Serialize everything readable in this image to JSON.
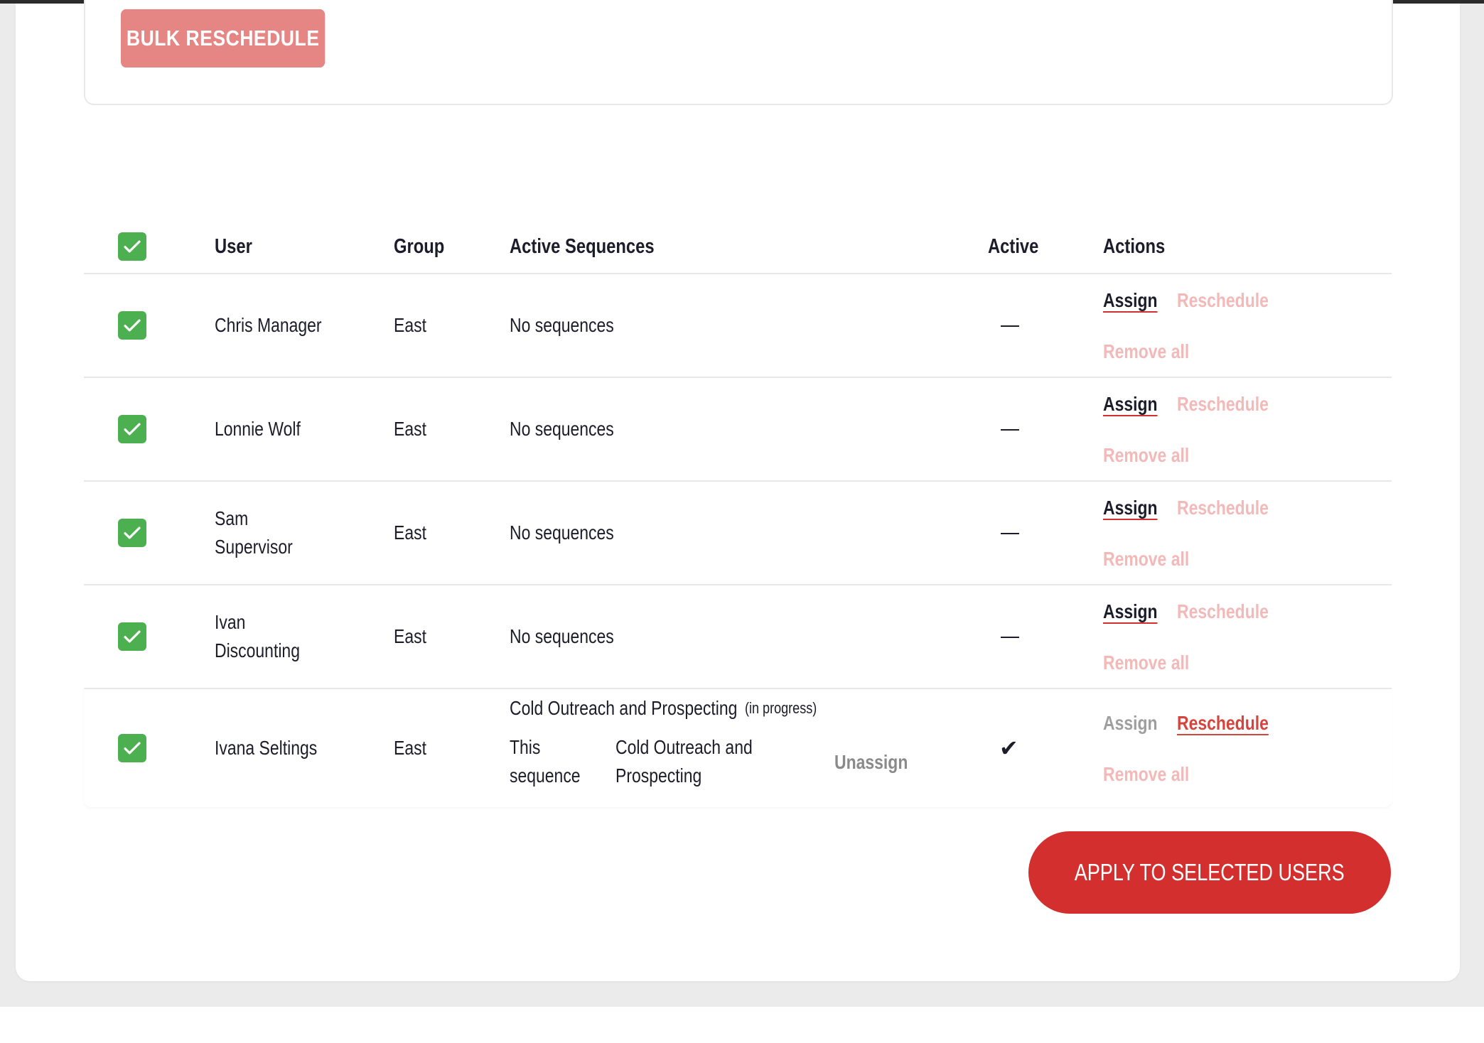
{
  "bulk": {
    "button_label": "BULK RESCHEDULE"
  },
  "table": {
    "headers": {
      "user": "User",
      "group": "Group",
      "active_sequences": "Active Sequences",
      "active": "Active",
      "actions": "Actions"
    },
    "rows": [
      {
        "user_line1": "Chris Manager",
        "user_line2": "",
        "group": "East",
        "sequences": "No sequences",
        "active": "—"
      },
      {
        "user_line1": "Lonnie Wolf",
        "user_line2": "",
        "group": "East",
        "sequences": "No sequences",
        "active": "—"
      },
      {
        "user_line1": "Sam",
        "user_line2": "Supervisor",
        "group": "East",
        "sequences": "No sequences",
        "active": "—"
      },
      {
        "user_line1": "Ivan",
        "user_line2": "Discounting",
        "group": "East",
        "sequences": "No sequences",
        "active": "—"
      },
      {
        "user_line1": "Ivana Seltings",
        "user_line2": "",
        "group": "East",
        "sequence_name": "Cold Outreach and Prospecting",
        "sequence_status": "(in progress)",
        "this_sequence_line1": "This",
        "this_sequence_line2": "sequence",
        "sequence_detail_line1": "Cold Outreach and",
        "sequence_detail_line2": "Prospecting",
        "unassign_label": "Unassign",
        "active": "✔"
      }
    ],
    "actions": {
      "assign": "Assign",
      "reschedule": "Reschedule",
      "remove_all": "Remove all"
    }
  },
  "footer": {
    "apply_label": "APPLY TO SELECTED USERS"
  },
  "colors": {
    "checkbox": "#4caf50",
    "primary": "#d32f2f",
    "bulk_button": "#e68684",
    "faded_link": "#f2b9b8"
  }
}
